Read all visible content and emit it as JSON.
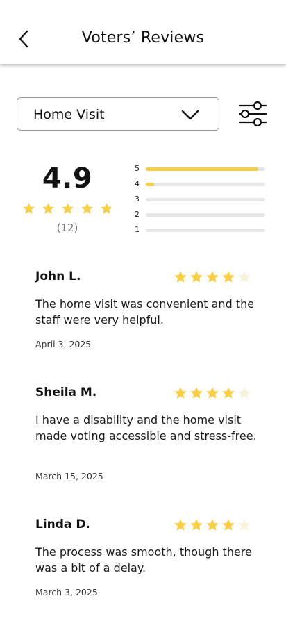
{
  "header": {
    "title": "Voters’ Reviews"
  },
  "filter": {
    "selected": "Home Visit"
  },
  "summary": {
    "rating": "4.9",
    "rating_value": 4.9,
    "count_text": "(12)",
    "distribution": [
      {
        "label": "5",
        "fraction": 0.94
      },
      {
        "label": "4",
        "fraction": 0.07
      },
      {
        "label": "3",
        "fraction": 0
      },
      {
        "label": "2",
        "fraction": 0
      },
      {
        "label": "1",
        "fraction": 0
      }
    ]
  },
  "reviews": [
    {
      "name": "John L.",
      "rating": 4,
      "text": "The home visit was convenient and the staff were very helpful.",
      "date": "April 3, 2025"
    },
    {
      "name": "Sheila M.",
      "rating": 4,
      "text": "I have a disability and the home visit made voting accessible and stress-free.",
      "date": "March 15, 2025"
    },
    {
      "name": "Linda D.",
      "rating": 4,
      "text": "The process was smooth, though there was a bit of a delay.",
      "date": "March 3, 2025"
    }
  ],
  "colors": {
    "star": "#f7ce45",
    "star_empty": "#f8f1dc",
    "bar_track": "#e7e7e7"
  },
  "icons": {
    "back": "chevron-left-icon",
    "dropdown": "chevron-down-icon",
    "filter": "sliders-icon",
    "star": "star-icon"
  }
}
